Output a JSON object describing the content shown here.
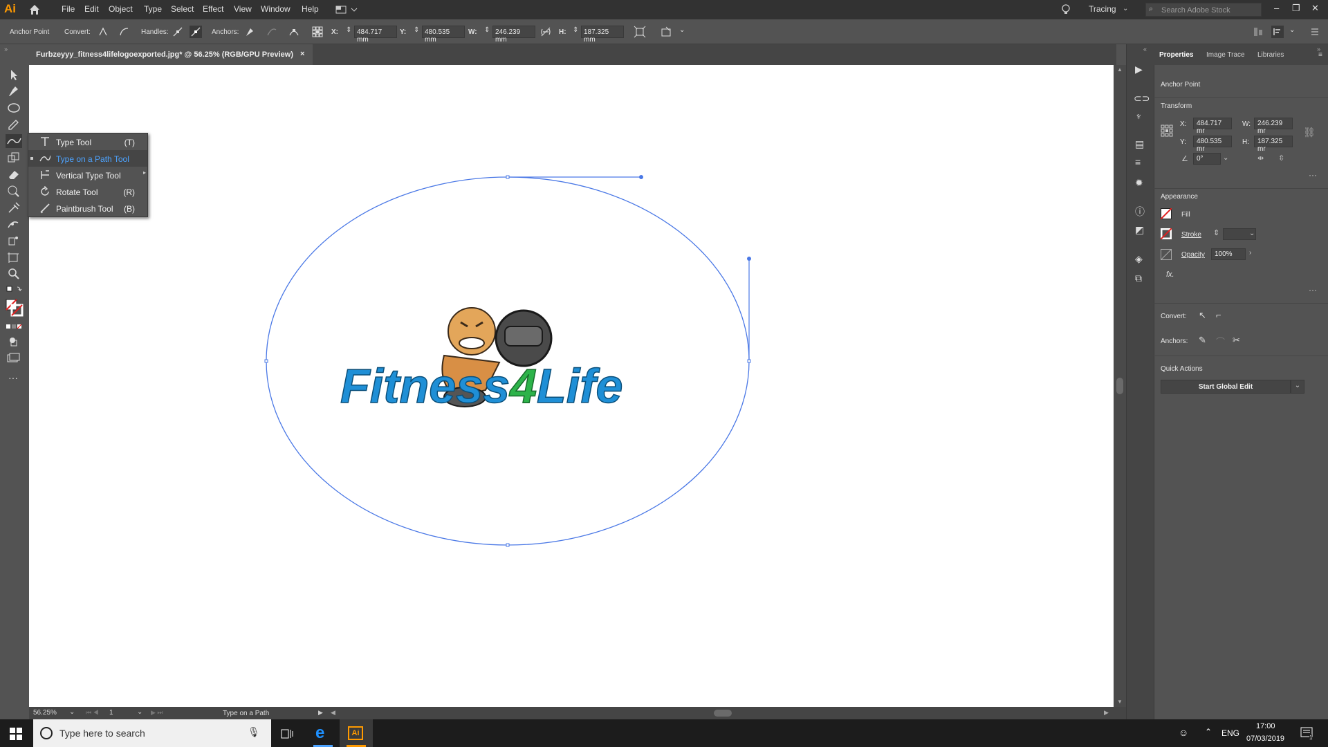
{
  "app": {
    "logo": "Ai",
    "workspace": "Tracing",
    "search_placeholder": "Search Adobe Stock"
  },
  "menu": [
    "File",
    "Edit",
    "Object",
    "Type",
    "Select",
    "Effect",
    "View",
    "Window",
    "Help"
  ],
  "control_bar": {
    "selection_label": "Anchor Point",
    "convert_label": "Convert:",
    "handles_label": "Handles:",
    "anchors_label": "Anchors:",
    "x_label": "X:",
    "x_value": "484.717 mm",
    "y_label": "Y:",
    "y_value": "480.535 mm",
    "w_label": "W:",
    "w_value": "246.239 mm",
    "h_label": "H:",
    "h_value": "187.325 mm"
  },
  "document_tab": {
    "title": "Furbzeyyy_fitness4lifelogoexported.jpg* @ 56.25% (RGB/GPU Preview)",
    "close": "×"
  },
  "tool_flyout": [
    {
      "label": "Type Tool",
      "shortcut": "(T)",
      "icon": "type-icon",
      "selected": false
    },
    {
      "label": "Type on a Path Tool",
      "shortcut": "",
      "icon": "type-on-path-icon",
      "selected": true
    },
    {
      "label": "Vertical Type Tool",
      "shortcut": "",
      "icon": "vertical-type-icon",
      "selected": false
    },
    {
      "label": "Rotate Tool",
      "shortcut": "(R)",
      "icon": "rotate-icon",
      "selected": false
    },
    {
      "label": "Paintbrush Tool",
      "shortcut": "(B)",
      "icon": "paintbrush-icon",
      "selected": false
    }
  ],
  "artwork": {
    "logo_text_a": "Fitness",
    "logo_text_b": "4",
    "logo_text_c": "Life"
  },
  "status_bar": {
    "zoom": "56.25%",
    "artboard": "1",
    "tool": "Type on a Path"
  },
  "properties_panel": {
    "tabs": [
      "Properties",
      "Image Trace",
      "Libraries"
    ],
    "active_tab": "Properties",
    "selection": "Anchor Point",
    "transform_heading": "Transform",
    "x_label": "X:",
    "x_value": "484.717 mr",
    "y_label": "Y:",
    "y_value": "480.535 mr",
    "w_label": "W:",
    "w_value": "246.239 mr",
    "h_label": "H:",
    "h_value": "187.325 mr",
    "angle_value": "0°",
    "appearance_heading": "Appearance",
    "fill_label": "Fill",
    "stroke_label": "Stroke",
    "opacity_label": "Opacity",
    "opacity_value": "100%",
    "fx_label": "fx.",
    "convert_label": "Convert:",
    "anchors_label": "Anchors:",
    "quick_actions_heading": "Quick Actions",
    "global_edit_button": "Start Global Edit"
  },
  "taskbar": {
    "search_placeholder": "Type here to search",
    "language": "ENG",
    "time": "17:00",
    "date": "07/03/2019",
    "notification_count": "1"
  },
  "colors": {
    "accent": "#4da3ff",
    "path": "#4a78e6",
    "logo_blue": "#1f8fd6",
    "logo_green": "#2db34a",
    "ai_orange": "#ff9a00"
  }
}
